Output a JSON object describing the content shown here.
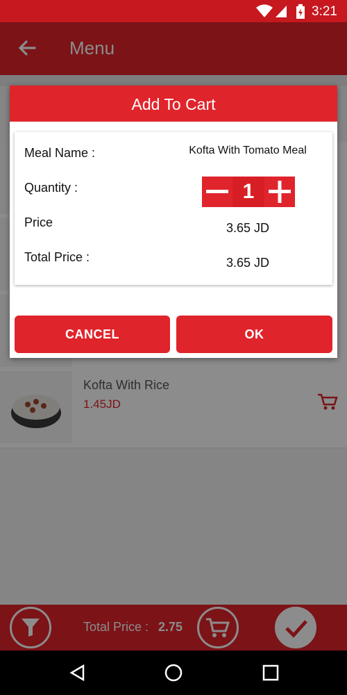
{
  "status_bar": {
    "time": "3:21"
  },
  "app_bar": {
    "title": "Menu"
  },
  "menu_items": [
    {
      "name": "Kofta With Rice",
      "price": "1.45JD"
    }
  ],
  "bottom_bar": {
    "total_label": "Total Price :",
    "total_value": "2.75"
  },
  "dialog": {
    "title": "Add To Cart",
    "meal_name_label": "Meal Name :",
    "meal_name_value": "Kofta With Tomato Meal",
    "quantity_label": "Quantity :",
    "quantity_value": "1",
    "price_label": "Price",
    "price_value": "3.65 JD",
    "total_price_label": "Total Price :",
    "total_price_value": "3.65 JD",
    "cancel_label": "CANCEL",
    "ok_label": "OK"
  },
  "colors": {
    "primary": "#e0242b",
    "status_bar": "#c7181f"
  }
}
